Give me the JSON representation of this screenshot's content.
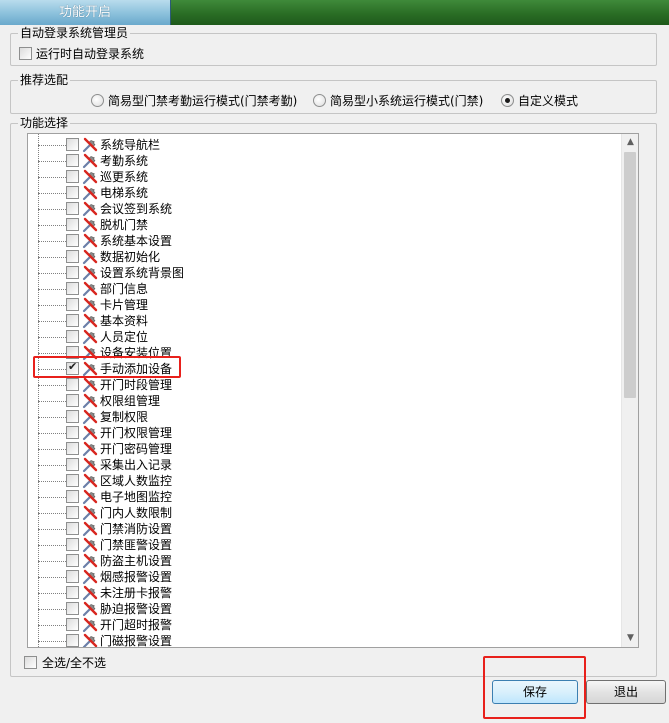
{
  "window": {
    "active_tab": "功能开启"
  },
  "auto_login": {
    "title": "自动登录系统管理员",
    "checkbox_label": "运行时自动登录系统",
    "checked": false
  },
  "recommend": {
    "title": "推荐选配",
    "options": [
      {
        "label": "简易型门禁考勤运行模式(门禁考勤)",
        "selected": false
      },
      {
        "label": "简易型小系统运行模式(门禁)",
        "selected": false
      },
      {
        "label": "自定义模式",
        "selected": true
      }
    ]
  },
  "features": {
    "title": "功能选择",
    "items": [
      {
        "label": "系统导航栏",
        "checked": false
      },
      {
        "label": "考勤系统",
        "checked": false
      },
      {
        "label": "巡更系统",
        "checked": false
      },
      {
        "label": "电梯系统",
        "checked": false
      },
      {
        "label": "会议签到系统",
        "checked": false
      },
      {
        "label": "脱机门禁",
        "checked": false
      },
      {
        "label": "系统基本设置",
        "checked": false
      },
      {
        "label": "数据初始化",
        "checked": false
      },
      {
        "label": "设置系统背景图",
        "checked": false
      },
      {
        "label": "部门信息",
        "checked": false
      },
      {
        "label": "卡片管理",
        "checked": false
      },
      {
        "label": "基本资料",
        "checked": false
      },
      {
        "label": "人员定位",
        "checked": false
      },
      {
        "label": "设备安装位置",
        "checked": false
      },
      {
        "label": "手动添加设备",
        "checked": true
      },
      {
        "label": "开门时段管理",
        "checked": false
      },
      {
        "label": "权限组管理",
        "checked": false
      },
      {
        "label": "复制权限",
        "checked": false
      },
      {
        "label": "开门权限管理",
        "checked": false
      },
      {
        "label": "开门密码管理",
        "checked": false
      },
      {
        "label": "采集出入记录",
        "checked": false
      },
      {
        "label": "区域人数监控",
        "checked": false
      },
      {
        "label": "电子地图监控",
        "checked": false
      },
      {
        "label": "门内人数限制",
        "checked": false
      },
      {
        "label": "门禁消防设置",
        "checked": false
      },
      {
        "label": "门禁匪警设置",
        "checked": false
      },
      {
        "label": "防盗主机设置",
        "checked": false
      },
      {
        "label": "烟感报警设置",
        "checked": false
      },
      {
        "label": "未注册卡报警",
        "checked": false
      },
      {
        "label": "胁迫报警设置",
        "checked": false
      },
      {
        "label": "开门超时报警",
        "checked": false
      },
      {
        "label": "门磁报警设置",
        "checked": false
      }
    ],
    "tree_item_icon": "tools-icon",
    "highlight_color": "#e8201b"
  },
  "select_all": {
    "label": "全选/全不选",
    "checked": false
  },
  "buttons": {
    "save": "保存",
    "exit": "退出"
  }
}
